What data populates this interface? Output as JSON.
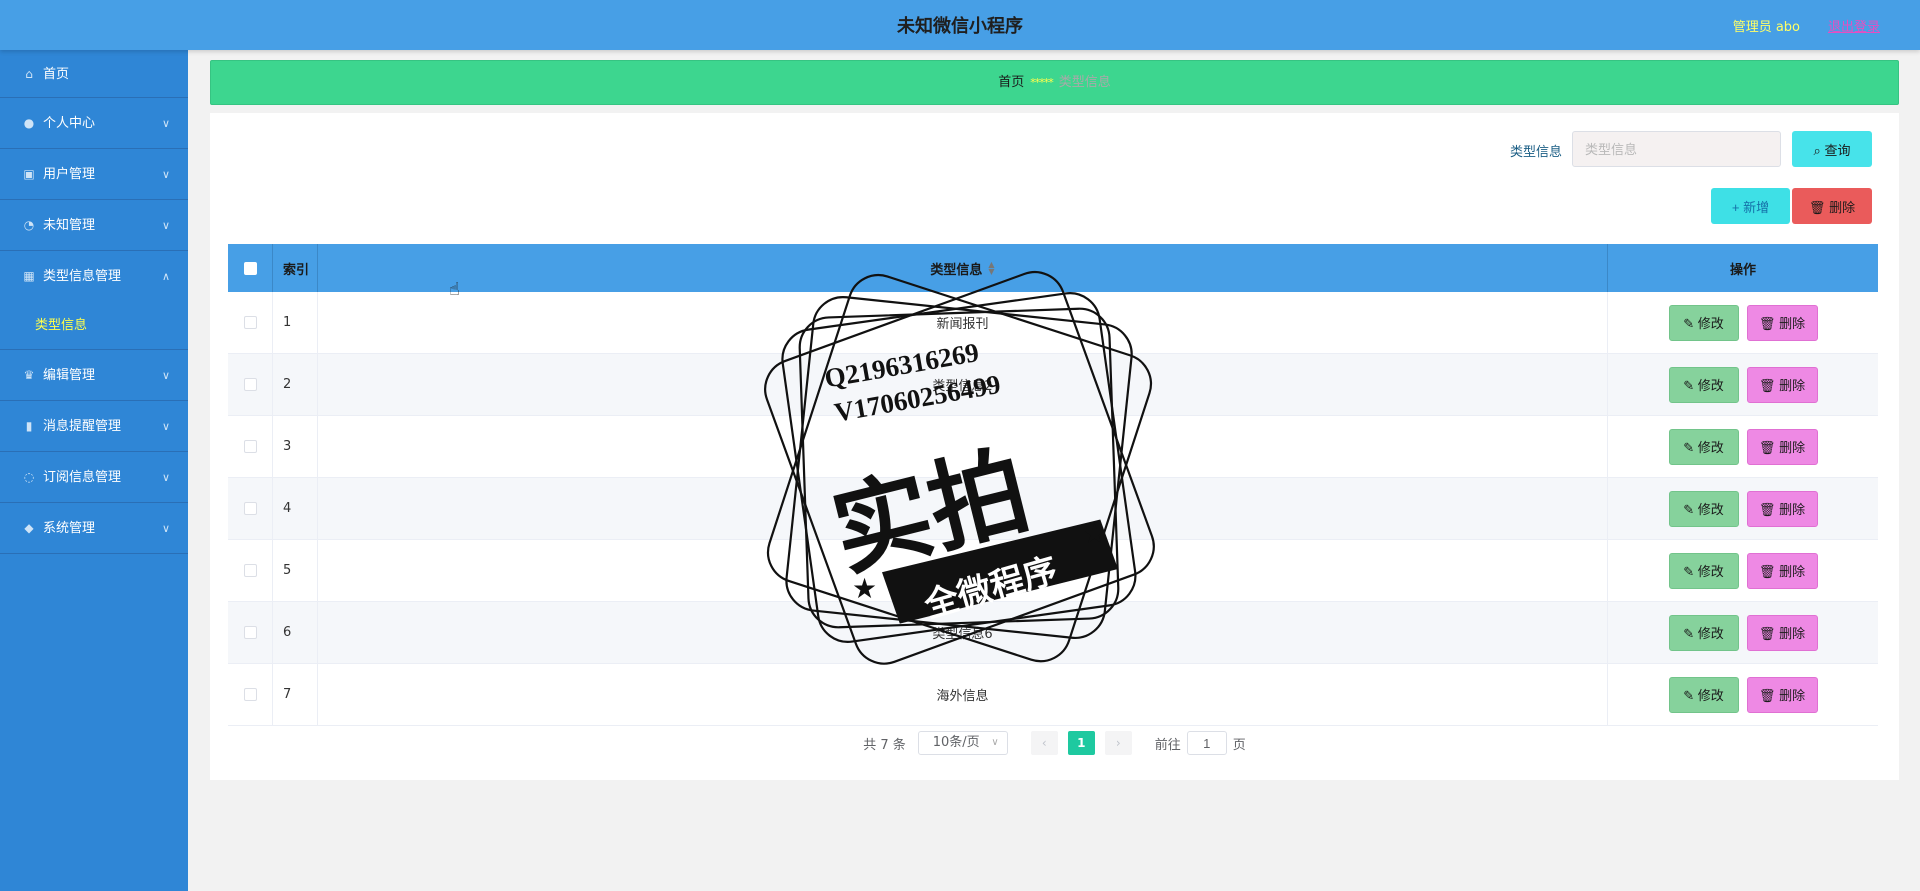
{
  "header": {
    "title": "未知微信小程序",
    "admin_label": "管理员 abo",
    "logout_label": "退出登录"
  },
  "sidebar": {
    "items": [
      {
        "label": "首页",
        "icon": "home-icon"
      },
      {
        "label": "个人中心",
        "icon": "user-icon"
      },
      {
        "label": "用户管理",
        "icon": "clipboard-icon"
      },
      {
        "label": "未知管理",
        "icon": "power-icon"
      },
      {
        "label": "类型信息管理",
        "icon": "grid-icon"
      },
      {
        "label": "编辑管理",
        "icon": "trophy-icon"
      },
      {
        "label": "消息提醒管理",
        "icon": "bar-chart-icon"
      },
      {
        "label": "订阅信息管理",
        "icon": "bell-icon"
      },
      {
        "label": "系统管理",
        "icon": "shield-icon"
      }
    ],
    "sub_item": "类型信息"
  },
  "breadcrumb": {
    "home": "首页",
    "separator": "*****",
    "current": "类型信息"
  },
  "search": {
    "label": "类型信息",
    "placeholder": "类型信息",
    "button": "查询"
  },
  "actions": {
    "add": "+ 新增",
    "delete": "删除"
  },
  "table": {
    "columns": {
      "index": "索引",
      "info": "类型信息",
      "ops": "操作"
    },
    "rows": [
      {
        "index": "1",
        "info": "新闻报刊"
      },
      {
        "index": "2",
        "info": "类型信息2"
      },
      {
        "index": "3",
        "info": ""
      },
      {
        "index": "4",
        "info": ""
      },
      {
        "index": "5",
        "info": ""
      },
      {
        "index": "6",
        "info": "类型信息6"
      },
      {
        "index": "7",
        "info": "海外信息"
      }
    ],
    "edit_label": "修改",
    "delete_label": "删除"
  },
  "pagination": {
    "total": "共 7 条",
    "page_size": "10条/页",
    "current_page": "1",
    "goto_prefix": "前往",
    "goto_value": "1",
    "goto_suffix": "页"
  },
  "watermark": {
    "line1": "Q2196316269",
    "line2": "V17060256499",
    "main": "实拍",
    "banner": "全微程序"
  },
  "colors": {
    "header": "#479fe6",
    "sidebar": "#2f86d6",
    "breadcrumb": "#3dd68f",
    "edit": "#86d29c",
    "delete_row": "#ee89e4",
    "delete_top": "#ea5b5b",
    "page_active": "#1ec9a0"
  }
}
